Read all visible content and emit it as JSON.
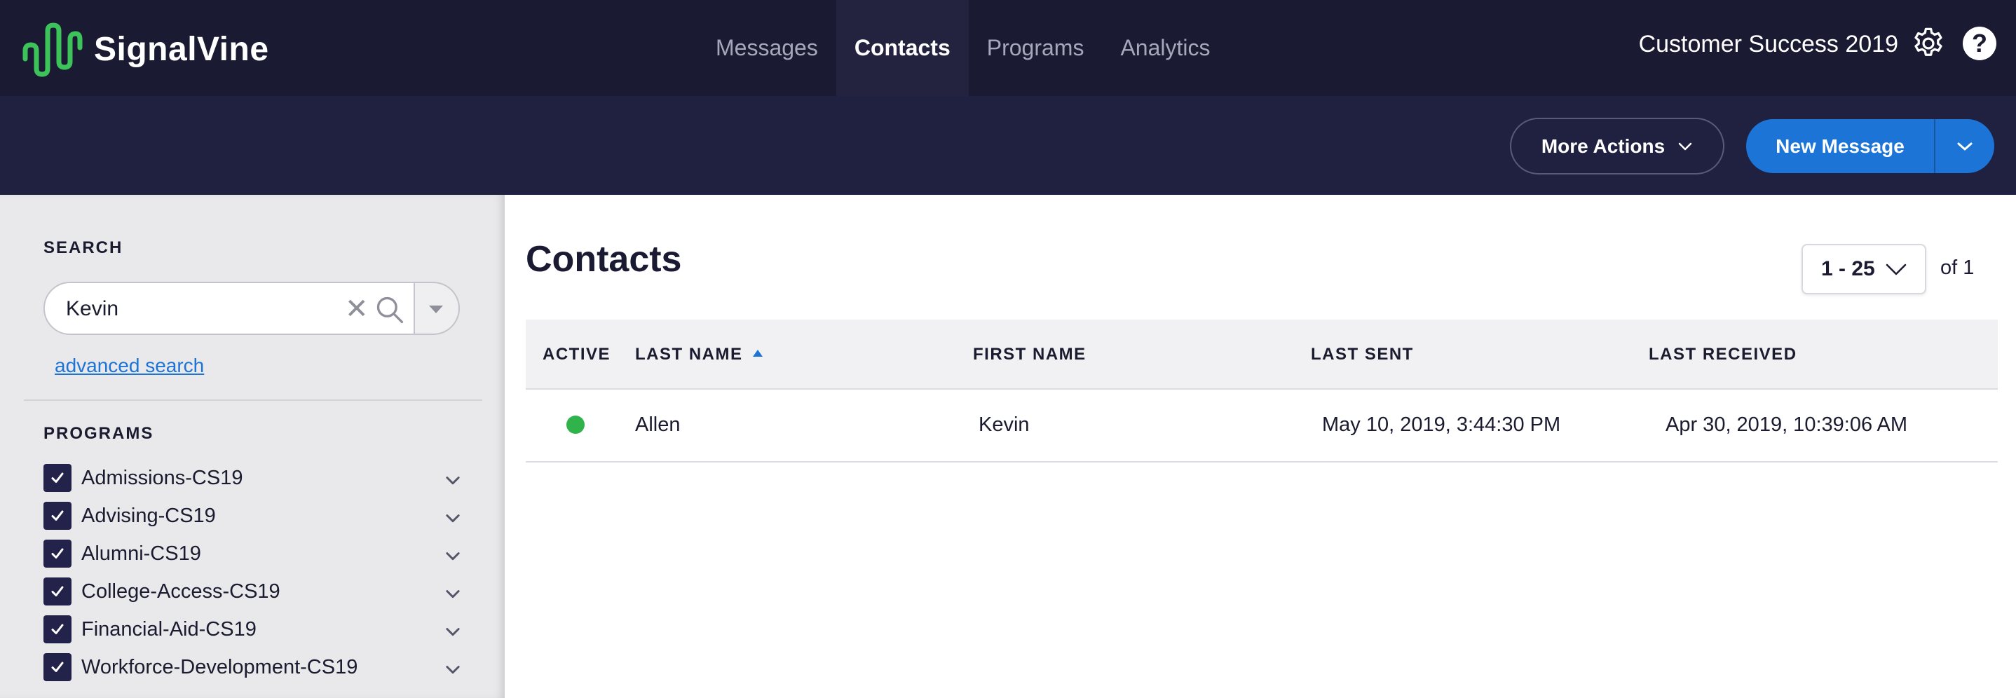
{
  "app": {
    "logo_text": "SignalVine",
    "nav": [
      "Messages",
      "Contacts",
      "Programs",
      "Analytics"
    ],
    "nav_active": "Contacts",
    "account_name": "Customer Success 2019"
  },
  "actions": {
    "more_actions": "More Actions",
    "new_message": "New Message"
  },
  "sidebar": {
    "search_label": "SEARCH",
    "search_value": "Kevin",
    "advanced_search": "advanced search",
    "programs_label": "PROGRAMS",
    "programs": [
      {
        "name": "Admissions-CS19",
        "checked": true
      },
      {
        "name": "Advising-CS19",
        "checked": true
      },
      {
        "name": "Alumni-CS19",
        "checked": true
      },
      {
        "name": "College-Access-CS19",
        "checked": true
      },
      {
        "name": "Financial-Aid-CS19",
        "checked": true
      },
      {
        "name": "Workforce-Development-CS19",
        "checked": true
      }
    ]
  },
  "main": {
    "title": "Contacts",
    "page_range": "1 - 25",
    "page_of": "of 1",
    "columns": [
      "ACTIVE",
      "LAST NAME",
      "FIRST NAME",
      "LAST SENT",
      "LAST RECEIVED"
    ],
    "sort_column": "LAST NAME",
    "rows": [
      {
        "active": true,
        "last_name": "Allen",
        "first_name": "Kevin",
        "last_sent": "May 10, 2019, 3:44:30 PM",
        "last_received": "Apr 30, 2019, 10:39:06 AM"
      }
    ]
  },
  "colors": {
    "nav_bg": "#1b1a33",
    "action_bg": "#202040",
    "accent_blue": "#1c74d6",
    "logo_green": "#3cc35a",
    "active_green": "#2fb34a"
  },
  "icons": [
    "logo-wave-icon",
    "gear-icon",
    "help-icon",
    "chevron-down-icon",
    "search-icon",
    "clear-icon",
    "checkmark-icon",
    "sort-ascending-icon",
    "status-dot-icon"
  ]
}
